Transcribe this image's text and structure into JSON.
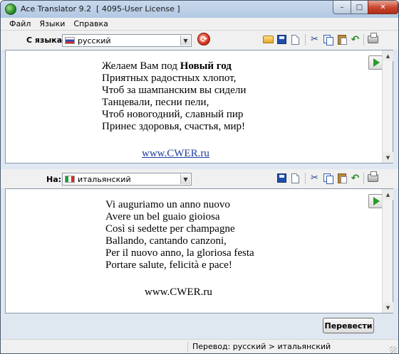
{
  "window": {
    "title": "Ace Translator 9.2  [ 4095-User License ]",
    "controls": {
      "minimize": "–",
      "maximize": "□",
      "close": "✕"
    }
  },
  "menu": [
    "Файл",
    "Языки",
    "Справка"
  ],
  "source": {
    "label": "С языка:",
    "language": "русский",
    "lines": [
      "Желаем Вам под ",
      "Приятных радостных хлопот,",
      "Чтоб за шампанским вы сидели",
      "Танцевали, песни пели,",
      "Чтоб новогодний, славный пир",
      "Принес здоровья, счастья, мир!"
    ],
    "bold_phrase": "Новый год",
    "link": "www.CWER.ru"
  },
  "target": {
    "label": "На:",
    "language": "итальянский",
    "lines": [
      "Vi auguriamo un anno nuovo",
      "Avere un bel guaio gioiosa",
      "Così si sedette per champagne",
      "Ballando, cantando canzoni,",
      "Per il nuovo anno, la gloriosa festa",
      "Portare salute, felicità e pace!"
    ],
    "link": "www.CWER.ru"
  },
  "translate_button": "Перевести",
  "status": "Перевод: русский > итальянский"
}
